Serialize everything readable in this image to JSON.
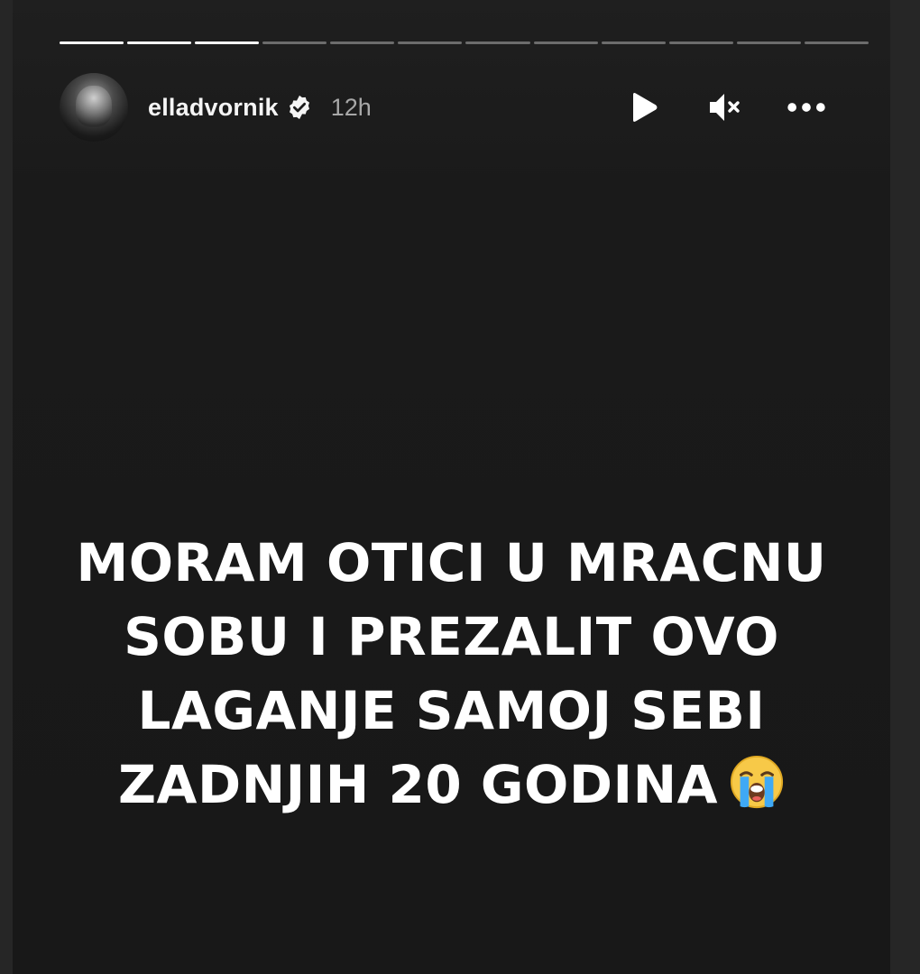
{
  "story": {
    "progress": {
      "total_segments": 12,
      "completed_segments": 3
    },
    "author": {
      "username": "elladvornik",
      "verified": true,
      "time_ago": "12h",
      "avatar_icon": "profile-photo"
    },
    "controls": {
      "play_icon": "play-icon",
      "mute_icon": "muted-speaker-icon",
      "more_icon": "more-options-icon"
    },
    "caption": {
      "lines": [
        "MORAM OTICI U MRACNU",
        "SOBU I PREZALIT OVO",
        "LAGANJE SAMOJ SEBI",
        "ZADNJIH 20 GODINA"
      ],
      "emoji": "loudly-crying-face"
    }
  },
  "colors": {
    "background": "#262626",
    "story_background": "#181818",
    "text": "#ffffff",
    "muted_text": "#a8a8a8",
    "emoji_face": "#f7c948",
    "emoji_tears": "#3fa9f5"
  }
}
